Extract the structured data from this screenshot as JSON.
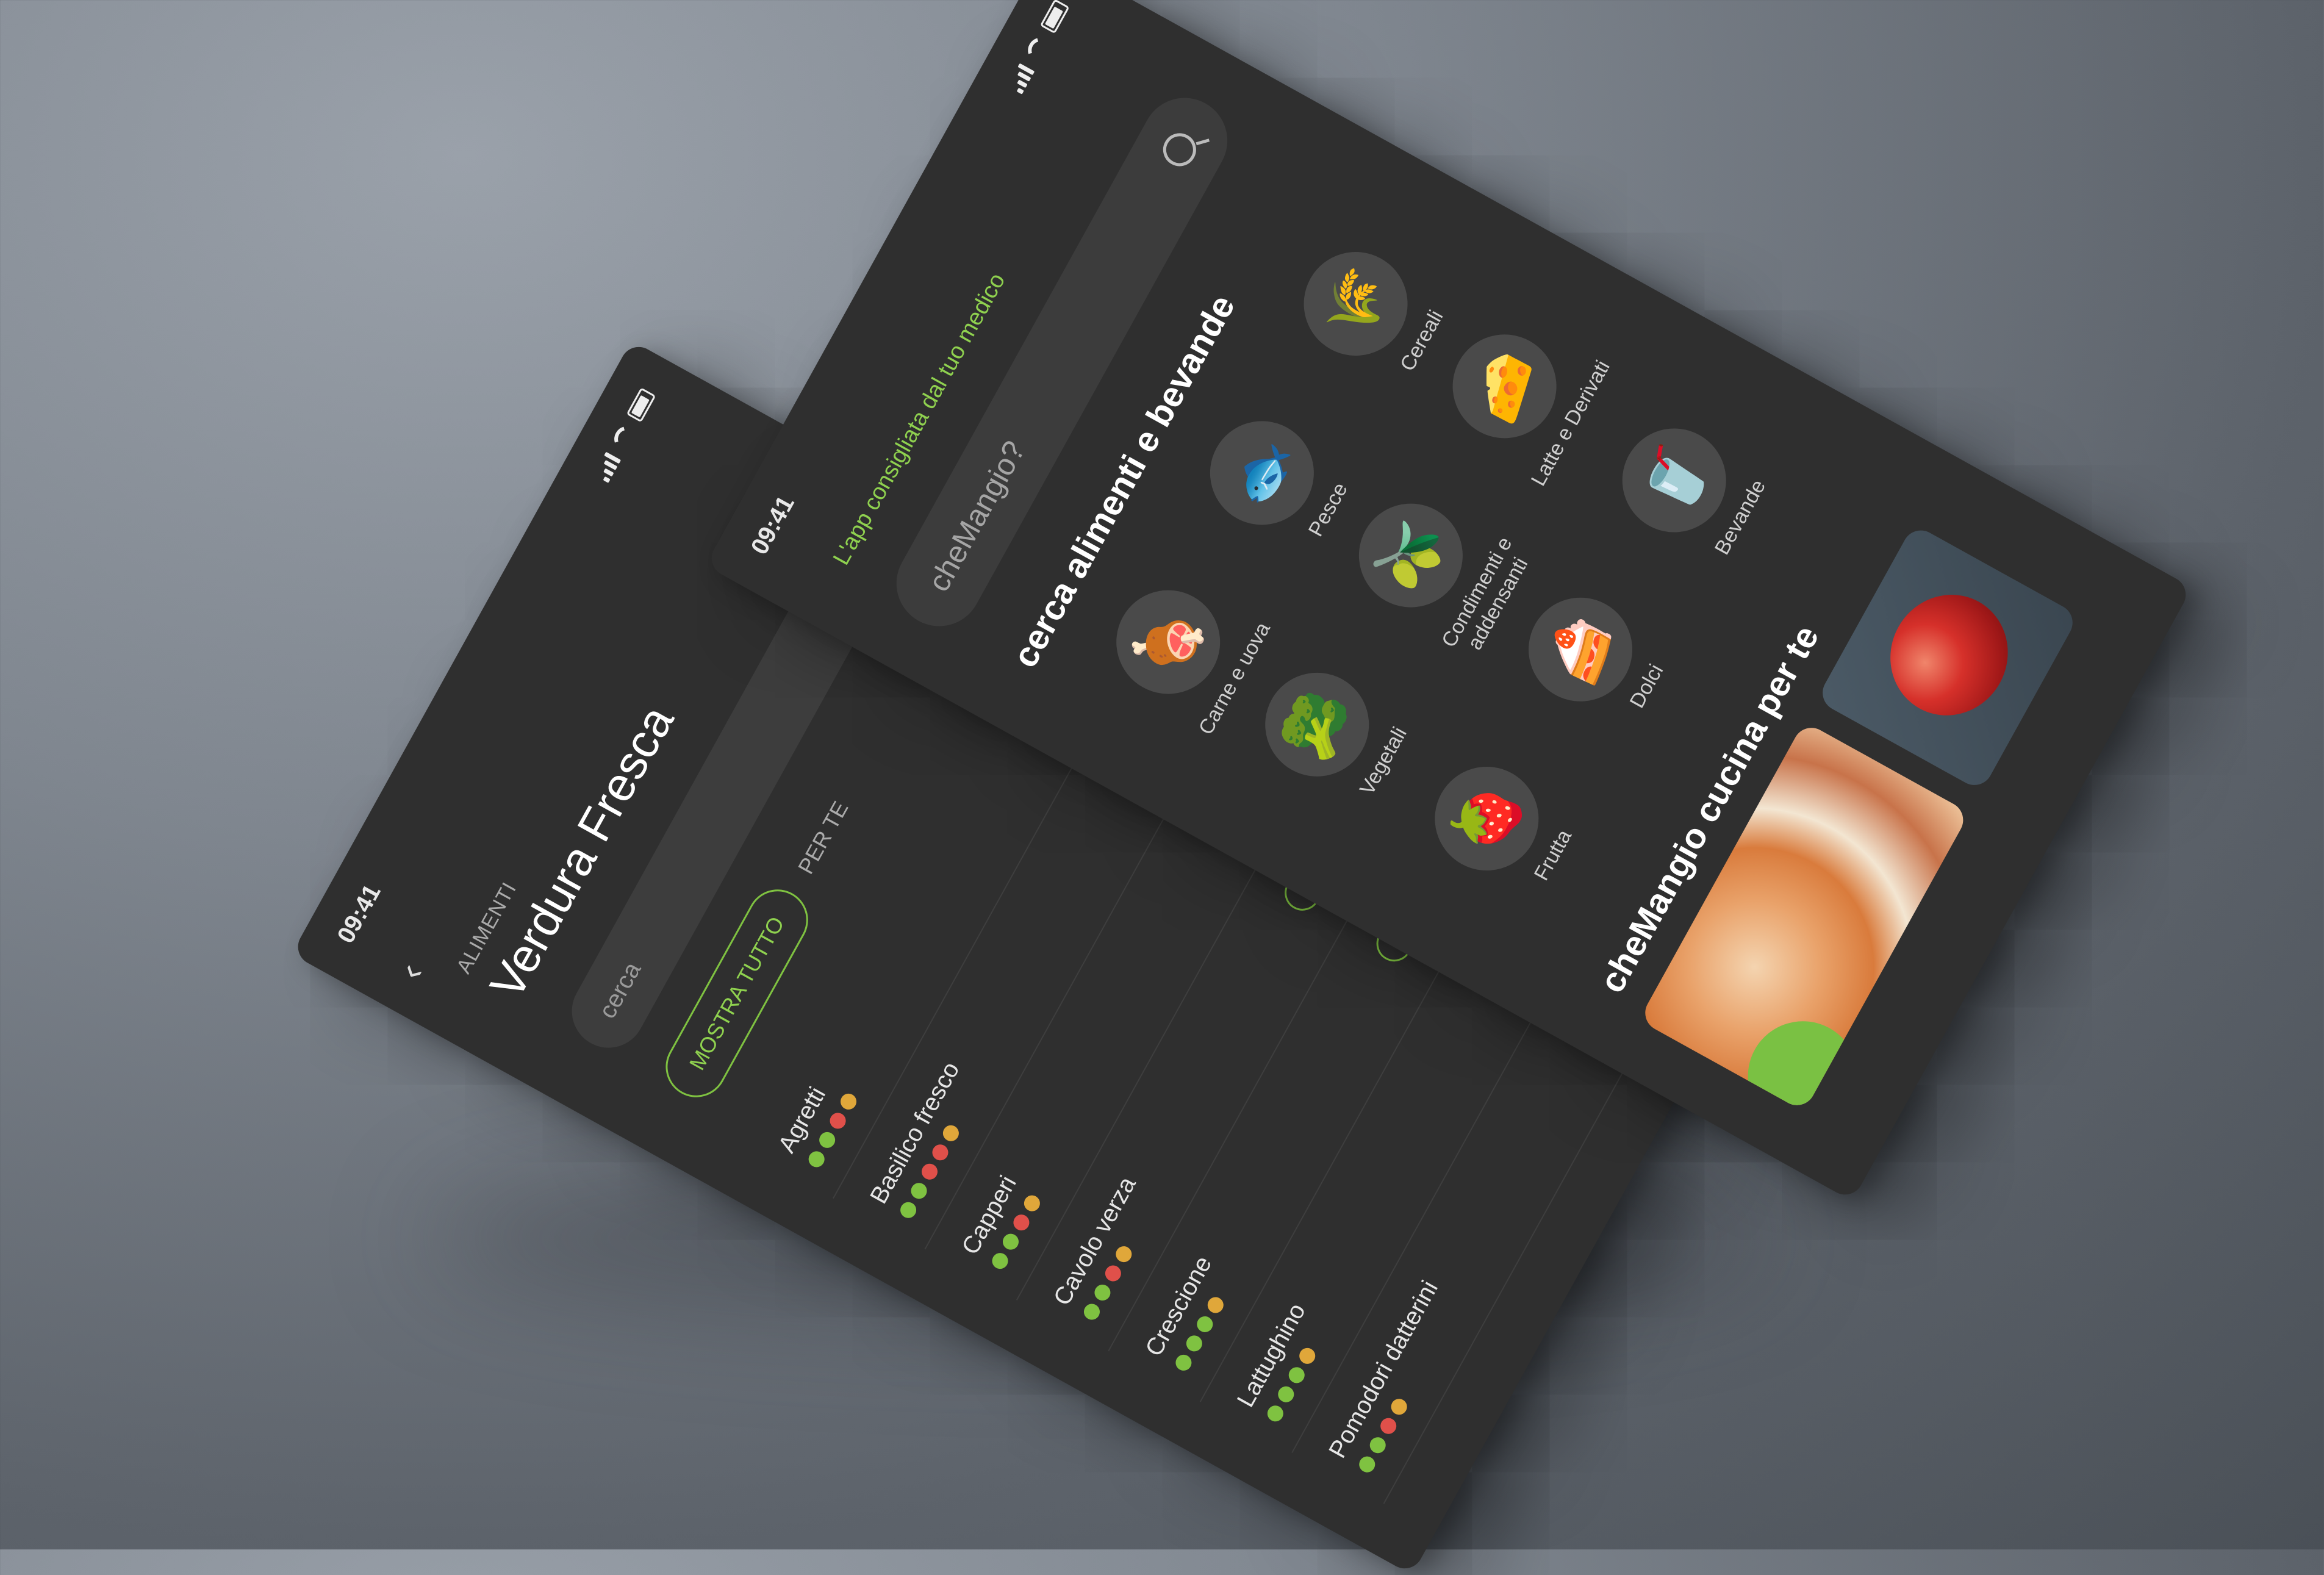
{
  "list_screen": {
    "status": {
      "time": "09:41"
    },
    "breadcrumb": "ALIMENTI",
    "title": "Verdura Fresca",
    "search_placeholder": "cerca",
    "tabs": [
      {
        "label": "MOSTRA TUTTO",
        "active": true
      },
      {
        "label": "PER TE",
        "active": false
      }
    ],
    "rows": [
      {
        "name": "Agretti",
        "badge": "",
        "dot_colors": [
          "#7fc241",
          "#7fc241",
          "#e0504a",
          "#e0a73a"
        ]
      },
      {
        "name": "Basilico fresco",
        "badge": "",
        "dot_colors": [
          "#7fc241",
          "#7fc241",
          "#e0504a",
          "#e0504a",
          "#e0a73a"
        ]
      },
      {
        "name": "Capperi",
        "badge": "",
        "dot_colors": [
          "#7fc241",
          "#7fc241",
          "#e0504a",
          "#e0a73a"
        ]
      },
      {
        "name": "Cavolo verza",
        "badge": "PER TE",
        "dot_colors": [
          "#7fc241",
          "#7fc241",
          "#e0504a",
          "#e0a73a"
        ]
      },
      {
        "name": "Crescione",
        "badge": "PER TE",
        "dot_colors": [
          "#7fc241",
          "#7fc241",
          "#7fc241",
          "#e0a73a"
        ]
      },
      {
        "name": "Lattughino",
        "badge": "",
        "dot_colors": [
          "#7fc241",
          "#7fc241",
          "#7fc241",
          "#e0a73a"
        ]
      },
      {
        "name": "Pomodori datterini",
        "badge": "",
        "dot_colors": [
          "#7fc241",
          "#7fc241",
          "#e0504a",
          "#e0a73a"
        ]
      }
    ]
  },
  "home_screen": {
    "status": {
      "time": "09:41"
    },
    "promo": "L'app consigliata dal tuo medico",
    "search_placeholder": "cheMangio?",
    "section_categories": "cerca alimenti e bevande",
    "categories": [
      {
        "label": "Carne e uova",
        "icon": "meat-egg-icon",
        "glyph": "🍖",
        "color": "#e0507a"
      },
      {
        "label": "Pesce",
        "icon": "fish-icon",
        "glyph": "🐟",
        "color": "#4a8fe0"
      },
      {
        "label": "Cereali",
        "icon": "wheat-icon",
        "glyph": "🌾",
        "color": "#d4a72c"
      },
      {
        "label": "Vegetali",
        "icon": "broccoli-icon",
        "glyph": "🥦",
        "color": "#4ea83a"
      },
      {
        "label": "Condimenti e addensanti",
        "icon": "oil-bottle-icon",
        "glyph": "🫒",
        "color": "#9cc23c"
      },
      {
        "label": "Latte e Derivati",
        "icon": "cheese-icon",
        "glyph": "🧀",
        "color": "#f0cf2a"
      },
      {
        "label": "Frutta",
        "icon": "strawberry-icon",
        "glyph": "🍓",
        "color": "#d93040"
      },
      {
        "label": "Dolci",
        "icon": "cake-icon",
        "glyph": "🍰",
        "color": "#a064d0"
      },
      {
        "label": "Bevande",
        "icon": "drink-icon",
        "glyph": "🥤",
        "color": "#2a6fd6"
      }
    ],
    "section_recipes": "cheMangio cucina per te"
  },
  "colors": {
    "accent": "#7fc241",
    "background_screen": "#2f2f2f"
  }
}
